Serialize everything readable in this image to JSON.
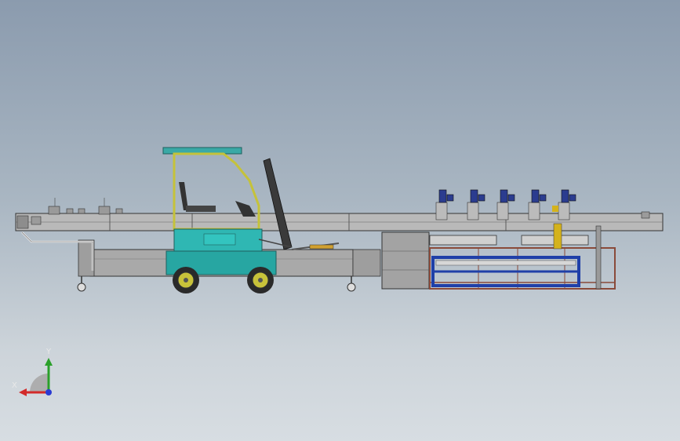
{
  "viewport": {
    "title": "",
    "background_top": "#8b9bae",
    "background_bottom": "#d7dde2"
  },
  "model": {
    "name": "",
    "frame_color": "#a9a9a9",
    "cab_color": "#2fb7b3",
    "canopy_color": "#3aa9a6",
    "wheel_color": "#c8c23a",
    "blue_frame_color": "#1f3fa8",
    "rust_frame_color": "#8a4a3a"
  },
  "triad": {
    "x_label": "X",
    "y_label": "Y",
    "x_color": "#d22a2a",
    "y_color": "#2aa02a",
    "z_color": "#2a3ad2",
    "icons": [
      "coordinate-triad-icon"
    ]
  }
}
